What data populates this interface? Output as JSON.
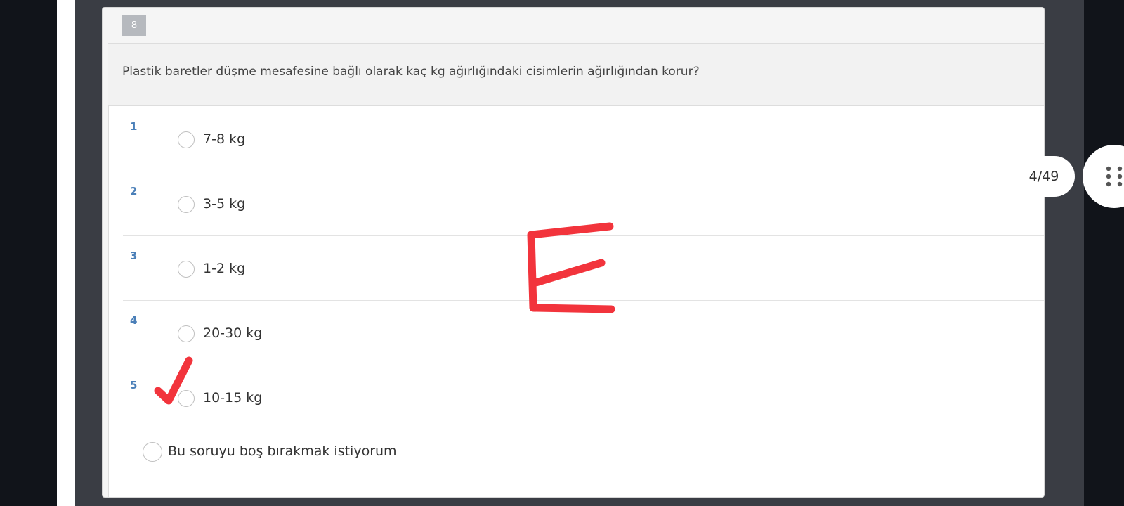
{
  "question": {
    "number": "8",
    "text": "Plastik baretler düşme mesafesine bağlı olarak kaç kg ağırlığındaki cisimlerin ağırlığından korur?"
  },
  "options": [
    {
      "num": "1",
      "label": "7-8 kg"
    },
    {
      "num": "2",
      "label": "3-5 kg"
    },
    {
      "num": "3",
      "label": "1-2 kg"
    },
    {
      "num": "4",
      "label": "20-30 kg"
    },
    {
      "num": "5",
      "label": "10-15 kg"
    }
  ],
  "skip_label": "Bu soruyu boş bırakmak istiyorum",
  "pager": {
    "text": "4/49"
  },
  "icons": {
    "menu": "grip-dots-icon",
    "checkmark": "handwritten-checkmark-icon"
  },
  "colors": {
    "annotation": "#f2343c",
    "option_number": "#4a7fb8"
  }
}
